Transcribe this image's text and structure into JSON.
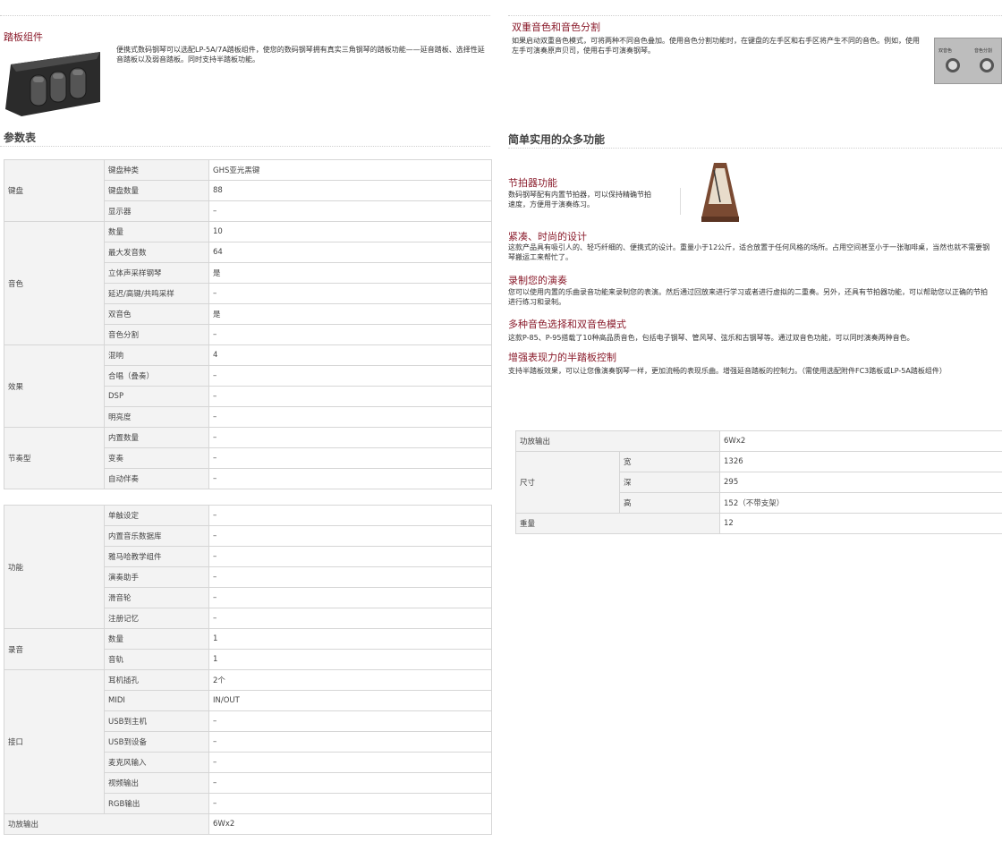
{
  "pedal": {
    "title": "踏板组件",
    "desc": "便携式数码钢琴可以选配LP-5A/7A踏板组件，使您的数码钢琴拥有真实三角钢琴的踏板功能——延音踏板、选择性延音踏板以及弱音踏板。同时支持半踏板功能。"
  },
  "dual": {
    "title": "双重音色和音色分割",
    "desc": "如果启动双重音色模式，可将两种不同音色叠加。使用音色分割功能时，在键盘的左手区和右手区将产生不同的音色。例如，使用左手可演奏原声贝司，使用右手可演奏钢琴。",
    "btn1": "双音色",
    "btn2": "音色分割"
  },
  "spec_title": "参数表",
  "features_title": "简单实用的众多功能",
  "features": [
    {
      "title": "节拍器功能",
      "desc": "数码钢琴配有内置节拍器，可以保持精确节拍速度，方便用于演奏练习。"
    },
    {
      "title": "紧凑、时尚的设计",
      "desc": "这款产品具有吸引人的、轻巧纤细的、便携式的设计。重量小于12公斤，适合放置于任何风格的场所。占用空间甚至小于一张咖啡桌，当然也就不需要钢琴搬运工来帮忙了。"
    },
    {
      "title": "录制您的演奏",
      "desc": "您可以使用内置的乐曲录音功能来录制您的表演。然后通过回放来进行学习或者进行虚拟的二重奏。另外，还具有节拍器功能，可以帮助您以正确的节拍进行练习和录制。"
    },
    {
      "title": "多种音色选择和双音色模式",
      "desc": "这款P-85、P-95搭载了10种高品质音色，包括电子钢琴、管风琴、弦乐和古钢琴等。通过双音色功能，可以同时演奏两种音色。"
    },
    {
      "title": "增强表现力的半踏板控制",
      "desc": "支持半踏板效果，可以让您像演奏钢琴一样，更加流畅的表现乐曲。增强延音踏板的控制力。（需使用选配附件FC3踏板或LP-5A踏板组件）"
    }
  ],
  "table1": [
    {
      "group": "键盘",
      "rows": [
        [
          "键盘种类",
          "GHS亚光黑键"
        ],
        [
          "键盘数量",
          "88"
        ],
        [
          "显示器",
          "–"
        ]
      ]
    },
    {
      "group": "音色",
      "rows": [
        [
          "数量",
          "10"
        ],
        [
          "最大发音数",
          "64"
        ],
        [
          "立体声采样钢琴",
          "是"
        ],
        [
          "延迟/高键/共鸣采样",
          "–"
        ],
        [
          "双音色",
          "是"
        ],
        [
          "音色分割",
          "–"
        ]
      ]
    },
    {
      "group": "效果",
      "rows": [
        [
          "混响",
          "4"
        ],
        [
          "合唱（叠奏）",
          "–"
        ],
        [
          "DSP",
          "–"
        ],
        [
          "明亮度",
          "–"
        ]
      ]
    },
    {
      "group": "节奏型",
      "rows": [
        [
          "内置数量",
          "–"
        ],
        [
          "变奏",
          "–"
        ],
        [
          "自动伴奏",
          "–"
        ]
      ]
    }
  ],
  "table2": [
    {
      "group": "功能",
      "rows": [
        [
          "单触设定",
          "–"
        ],
        [
          "内置音乐数据库",
          "–"
        ],
        [
          "雅马哈教学组件",
          "–"
        ],
        [
          "演奏助手",
          "–"
        ],
        [
          "滑音轮",
          "–"
        ],
        [
          "注册记忆",
          "–"
        ]
      ]
    },
    {
      "group": "录音",
      "rows": [
        [
          "数量",
          "1"
        ],
        [
          "音轨",
          "1"
        ]
      ]
    },
    {
      "group": "接口",
      "rows": [
        [
          "耳机插孔",
          "2个"
        ],
        [
          "MIDI",
          "IN/OUT"
        ],
        [
          "USB到主机",
          "–"
        ],
        [
          "USB到设备",
          "–"
        ],
        [
          "麦克风输入",
          "–"
        ],
        [
          "视频输出",
          "–"
        ],
        [
          "RGB输出",
          "–"
        ]
      ]
    }
  ],
  "table2_last": {
    "label": "功放输出",
    "value": "6Wx2"
  },
  "table3": {
    "amp": {
      "label": "功放输出",
      "value": "6Wx2"
    },
    "size": {
      "label": "尺寸",
      "rows": [
        [
          "宽",
          "1326"
        ],
        [
          "深",
          "295"
        ],
        [
          "高",
          "152（不带支架）"
        ]
      ]
    },
    "weight": {
      "label": "重量",
      "value": "12"
    }
  }
}
